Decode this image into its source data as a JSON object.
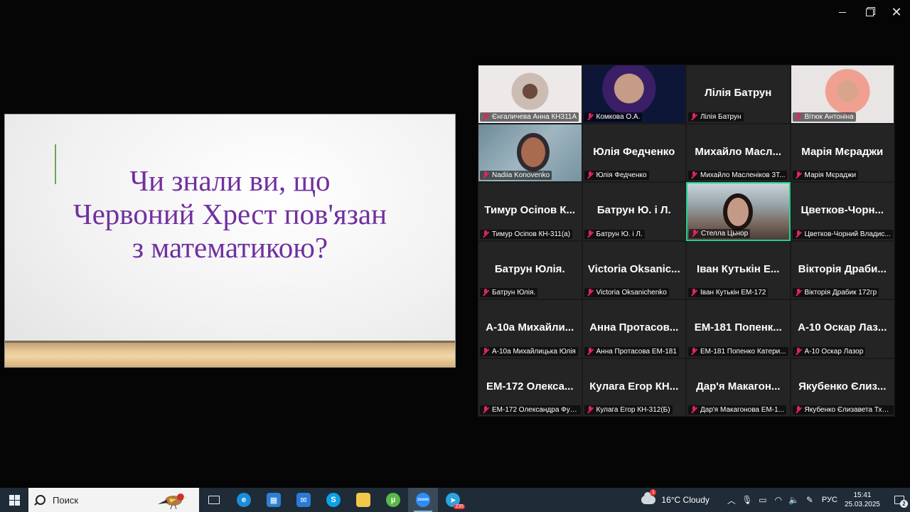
{
  "window_controls": {
    "minimize": "—",
    "maximize": "",
    "close": "✕"
  },
  "slide": {
    "title_lines": [
      "Чи знали ви, що",
      "Червоний Хрест пов'язан",
      "з математикою?"
    ],
    "title_color": "#7030a0"
  },
  "participants": [
    {
      "name": "Єнгаличева Анна КН311А",
      "big": "",
      "video": "v1"
    },
    {
      "name": "Комкова О.А.",
      "big": "",
      "video": "v2"
    },
    {
      "name": "Лілія Батрун",
      "big": "Лілія Батрун",
      "video": ""
    },
    {
      "name": "Вітюк Антоніна",
      "big": "",
      "video": "v4"
    },
    {
      "name": "Nadiia Konovenko",
      "big": "",
      "video": "v5"
    },
    {
      "name": "Юлія Федченко",
      "big": "Юлія Федченко",
      "video": ""
    },
    {
      "name": "Михайло Масленіков 3Т...",
      "big": "Михайло Масл...",
      "video": ""
    },
    {
      "name": "Марія Мєраджи",
      "big": "Марія Мєраджи",
      "video": ""
    },
    {
      "name": "Тимур Осіпов КН-311(а)",
      "big": "Тимур Осіпов К...",
      "video": ""
    },
    {
      "name": "Батрун Ю. і Л.",
      "big": "Батрун Ю. і Л.",
      "video": ""
    },
    {
      "name": "Стелла Цьнор",
      "big": "",
      "video": "v11",
      "active": true
    },
    {
      "name": "Цветков-Чорний Владис...",
      "big": "Цветков-Чорн...",
      "video": ""
    },
    {
      "name": "Батрун Юлія.",
      "big": "Батрун Юлія.",
      "video": ""
    },
    {
      "name": "Victoria Oksanichenko",
      "big": "Victoria Oksanic...",
      "video": ""
    },
    {
      "name": "Іван Кутькін ЕМ-172",
      "big": "Іван Кутькін Е...",
      "video": ""
    },
    {
      "name": "Вікторія Драбик 172гр",
      "big": "Вікторія Драби...",
      "video": ""
    },
    {
      "name": "А-10а Михайлицька Юлія",
      "big": "А-10а Михайли...",
      "video": ""
    },
    {
      "name": "Анна Протасова ЕМ-181",
      "big": "Анна Протасов...",
      "video": ""
    },
    {
      "name": "ЕМ-181 Попенко Катери...",
      "big": "ЕМ-181 Попенк...",
      "video": ""
    },
    {
      "name": "А-10 Оскар Лазор",
      "big": "А-10 Оскар Лаз...",
      "video": ""
    },
    {
      "name": "ЕМ-172 Олександра Фуз...",
      "big": "ЕМ-172 Олекса...",
      "video": ""
    },
    {
      "name": "Кулага Егор КН-312(Б)",
      "big": "Кулага Егор КН...",
      "video": ""
    },
    {
      "name": "Дар'я Макагонова ЕМ-1...",
      "big": "Дар'я Макагон...",
      "video": ""
    },
    {
      "name": "Якубенко Єлизавета Тх-1...",
      "big": "Якубенко Єлиз...",
      "video": ""
    }
  ],
  "taskbar": {
    "search_placeholder": "Поиск",
    "apps": [
      {
        "id": "task-view",
        "label": "",
        "color": "#1f2b36"
      },
      {
        "id": "edge",
        "label": "e",
        "color": "#1a8fd8"
      },
      {
        "id": "store",
        "label": "▦",
        "color": "#2d7fd6"
      },
      {
        "id": "mail",
        "label": "✉",
        "color": "#2a7ad8"
      },
      {
        "id": "skype",
        "label": "S",
        "color": "#0aa1e8"
      },
      {
        "id": "explorer",
        "label": "",
        "color": "#f2c84b"
      },
      {
        "id": "utorrent",
        "label": "µ",
        "color": "#58b947"
      },
      {
        "id": "zoom",
        "label": "zoom",
        "color": "#2d8cff",
        "active": true
      },
      {
        "id": "telegram",
        "label": "➤",
        "color": "#2aa3df",
        "badge": "235"
      }
    ],
    "weather_badge": "1",
    "weather": "16°C  Cloudy",
    "language": "РУС",
    "time": "15:41",
    "date": "25.03.2025",
    "notifications": "2"
  }
}
